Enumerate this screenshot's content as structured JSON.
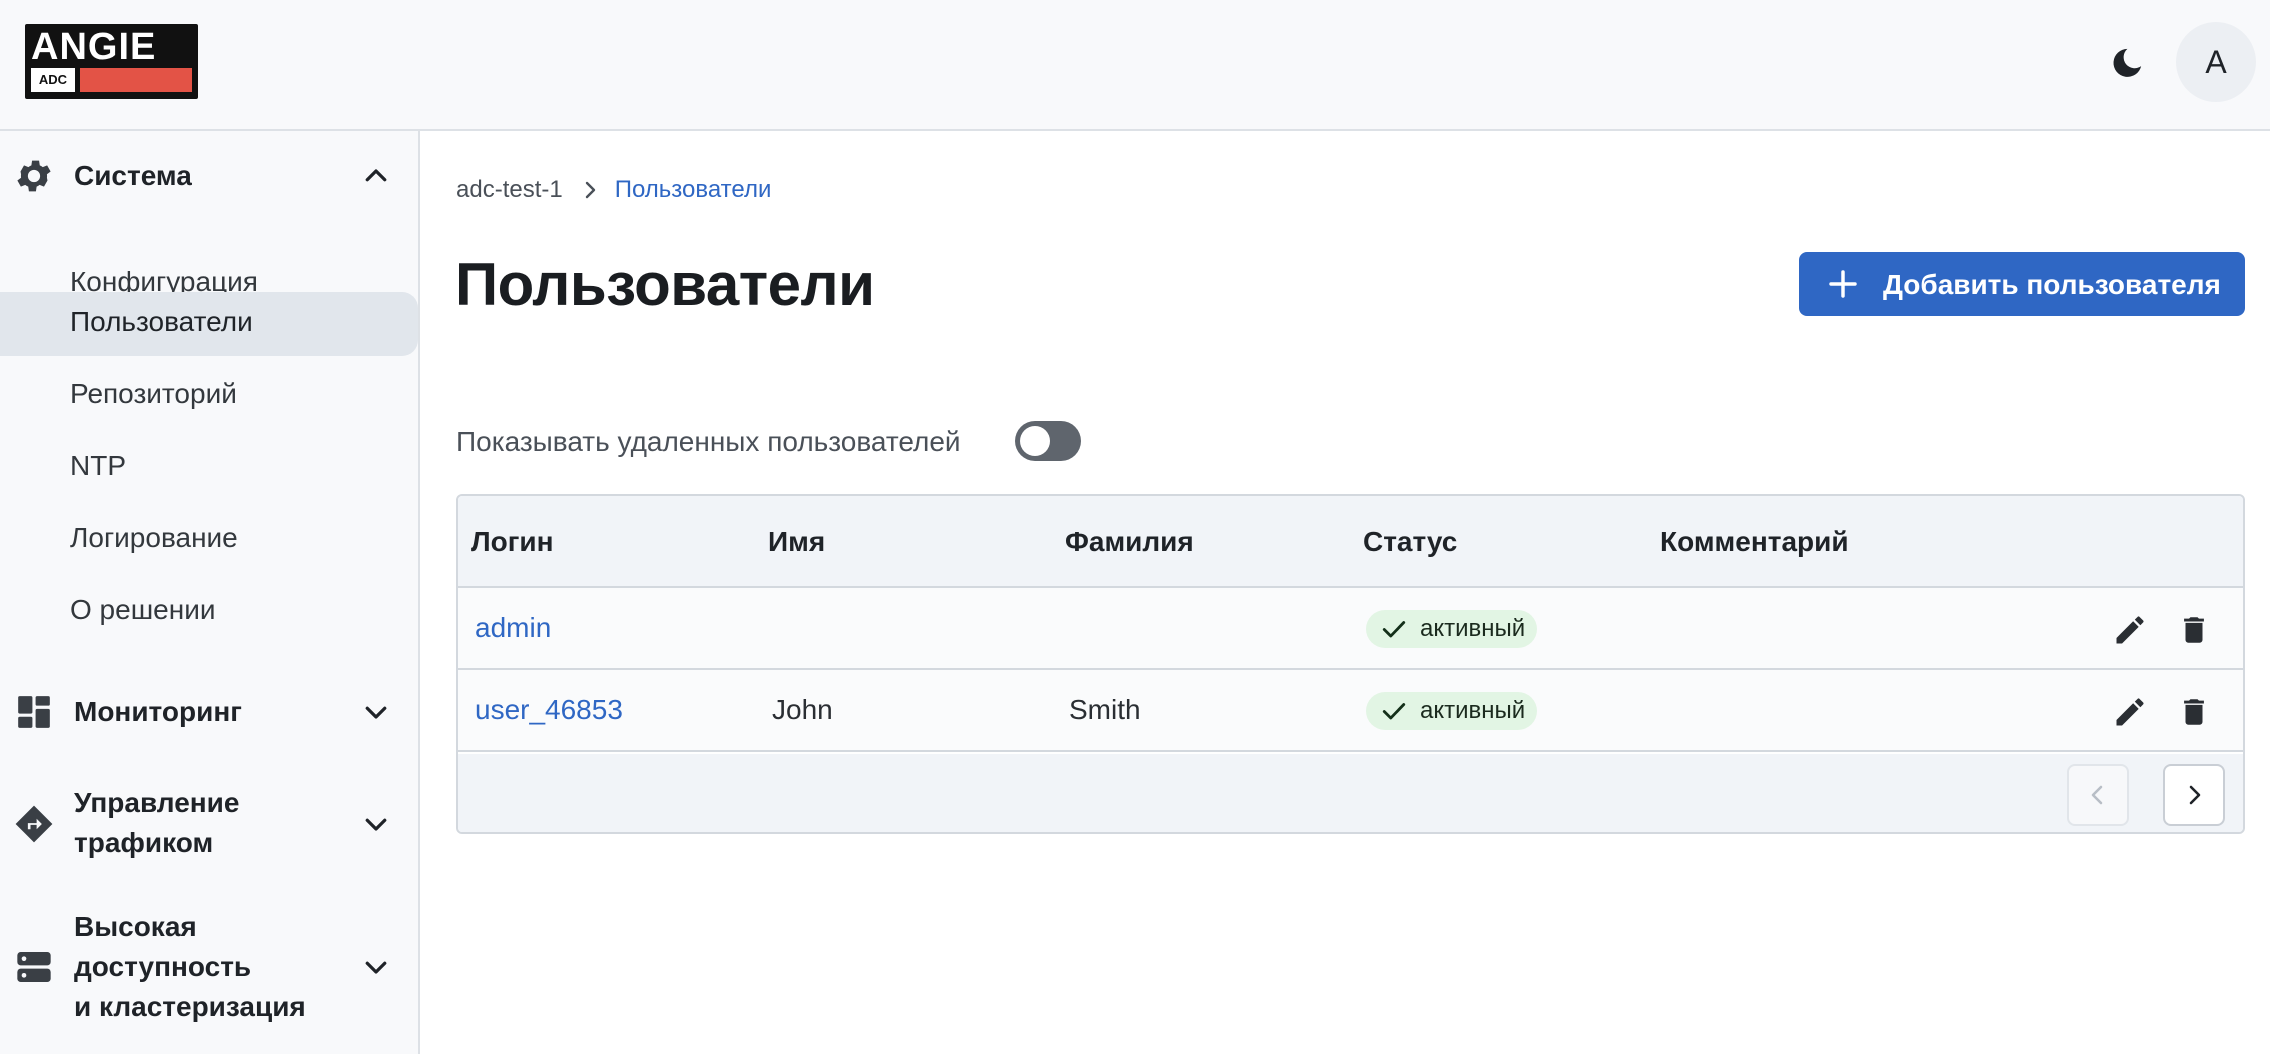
{
  "header": {
    "logo_text": "ANGIE",
    "logo_sub": "ADC",
    "theme_icon": "moon-icon",
    "avatar_letter": "A"
  },
  "sidebar": {
    "groups": [
      {
        "label": "Система",
        "icon": "gear-icon",
        "expanded": true,
        "items": [
          {
            "label": "Конфигурация",
            "active": false
          },
          {
            "label": "Пользователи",
            "active": true
          },
          {
            "label": "Репозиторий",
            "active": false
          },
          {
            "label": "NTP",
            "active": false
          },
          {
            "label": "Логирование",
            "active": false
          },
          {
            "label": "О решении",
            "active": false
          }
        ]
      },
      {
        "label": "Мониторинг",
        "icon": "dashboard-icon",
        "expanded": false
      },
      {
        "label_line1": "Управление",
        "label_line2": "трафиком",
        "icon": "route-sign-icon",
        "expanded": false
      },
      {
        "label_line1": "Высокая",
        "label_line2": "доступность",
        "label_line3": "и кластеризация",
        "icon": "server-icon",
        "expanded": false
      }
    ]
  },
  "breadcrumb": {
    "root": "adc-test-1",
    "current": "Пользователи"
  },
  "page": {
    "title": "Пользователи",
    "add_button_label": "Добавить пользователя",
    "toggle_label": "Показывать удаленных пользователей",
    "toggle_on": false
  },
  "table": {
    "columns": [
      "Логин",
      "Имя",
      "Фамилия",
      "Статус",
      "Комментарий"
    ],
    "rows": [
      {
        "login": "admin",
        "first_name": "",
        "last_name": "",
        "status": "активный",
        "comment": ""
      },
      {
        "login": "user_46853",
        "first_name": "John",
        "last_name": "Smith",
        "status": "активный",
        "comment": ""
      }
    ]
  },
  "colors": {
    "accent": "#2f67c4",
    "logo_red": "#e35346",
    "status_bg": "#e2f5e4"
  }
}
